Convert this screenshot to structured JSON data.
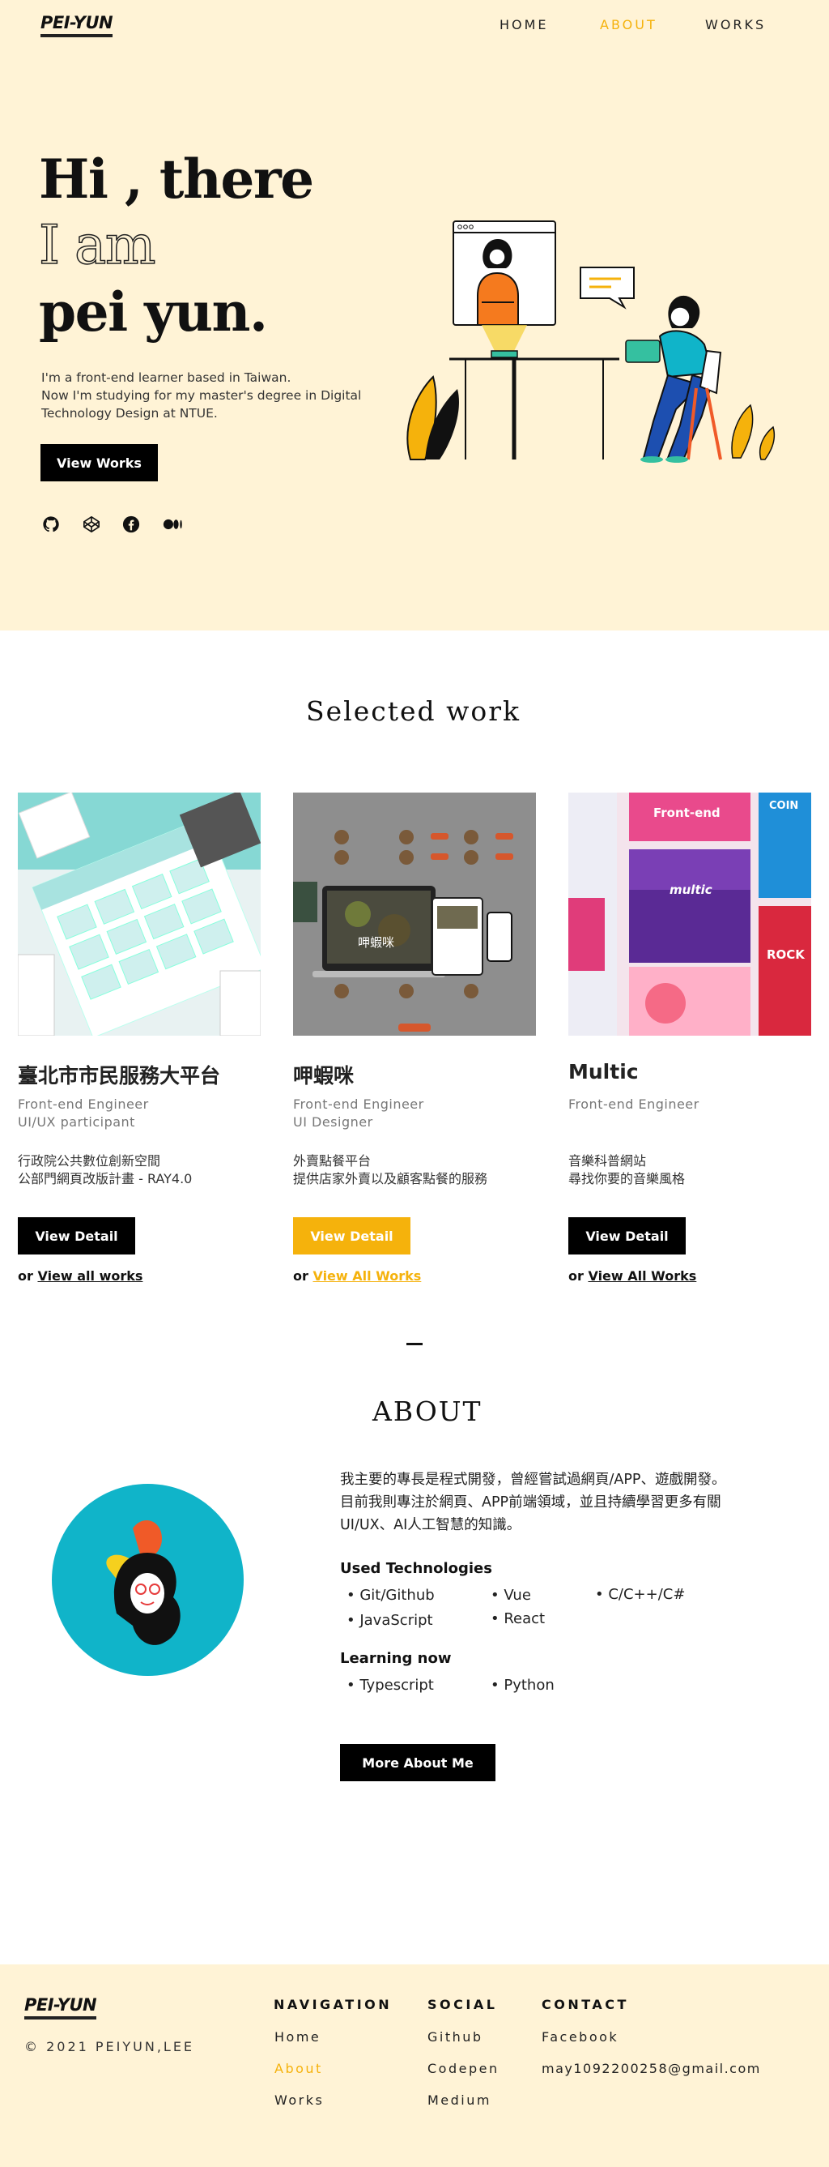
{
  "brand": {
    "logo": "PEI-YUN"
  },
  "nav": {
    "home": "HOME",
    "about": "ABOUT",
    "works": "WORKS"
  },
  "hero": {
    "line1": "Hi , there",
    "line2": "I am",
    "line3": "pei yun.",
    "intro": [
      "I'm a front-end learner based in Taiwan.",
      "Now I'm studying for my master's degree in Digital",
      "Technology Design at NTUE."
    ],
    "button": "View Works",
    "socials": [
      "github-icon",
      "codepen-icon",
      "facebook-icon",
      "medium-icon"
    ]
  },
  "selected": {
    "title": "Selected work",
    "cards": [
      {
        "title": "臺北市市民服務大平台",
        "roles": [
          "Front-end Engineer",
          "UI/UX participant"
        ],
        "desc": [
          "行政院公共數位創新空間",
          "公部門網頁改版計畫 - RAY4.0"
        ],
        "button": "View Detail",
        "more_prefix": "or",
        "more_link": "View all works"
      },
      {
        "title": "呷蝦咪",
        "roles": [
          "Front-end Engineer",
          "UI Designer"
        ],
        "desc": [
          "外賣點餐平台",
          "提供店家外賣以及顧客點餐的服務"
        ],
        "button": "View Detail",
        "more_prefix": "or",
        "more_link": "View All Works",
        "image_text": "呷蝦咪"
      },
      {
        "title": "Multic",
        "roles": [
          "Front-end Engineer"
        ],
        "desc": [
          "音樂科普網站",
          "尋找你要的音樂風格"
        ],
        "button": "View Detail",
        "more_prefix": "or",
        "more_link": "View All Works",
        "image_text": {
          "banner": "Front-end",
          "logo": "multic",
          "coin": "COIN",
          "rock": "ROCK"
        }
      }
    ]
  },
  "about": {
    "title": "ABOUT",
    "bio": [
      "我主要的專長是程式開發，曾經嘗試過網頁/APP、遊戲開發。",
      "目前我則專注於網頁、APP前端領域，並且持續學習更多有關",
      "UI/UX、AI人工智慧的知識。"
    ],
    "tech_heading": "Used Technologies",
    "tech": [
      "Git/Github",
      "JavaScript",
      "Vue",
      "React",
      "C/C++/C#"
    ],
    "learning_heading": "Learning now",
    "learning": [
      "Typescript",
      "Python"
    ],
    "button": "More About Me"
  },
  "footer": {
    "logo": "PEI-YUN",
    "copyright": "© 2021 PEIYUN,LEE",
    "navigation": {
      "heading": "NAVIGATION",
      "links": [
        "Home",
        "About",
        "Works"
      ]
    },
    "social": {
      "heading": "SOCIAL",
      "links": [
        "Github",
        "Codepen",
        "Medium"
      ]
    },
    "contact": {
      "heading": "CONTACT",
      "links": [
        "Facebook",
        "may1092200258@gmail.com"
      ]
    }
  },
  "colors": {
    "accent": "#F5B20C",
    "cream": "#FFF3D6",
    "teal": "#10B4C9"
  }
}
